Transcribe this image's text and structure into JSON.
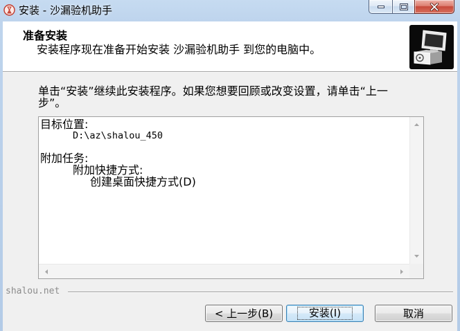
{
  "window": {
    "title": "安装 - 沙漏验机助手"
  },
  "header": {
    "title": "准备安装",
    "subtitle": "安装程序现在准备开始安装 沙漏验机助手 到您的电脑中。"
  },
  "body": {
    "instruction": "单击“安装”继续此安装程序。如果您想要回顾或改变设置，请单击“上一步”。"
  },
  "memo": {
    "sections": [
      {
        "label": "目标位置:",
        "items": [
          "D:\\az\\shalou_450"
        ]
      },
      {
        "label": "附加任务:",
        "groups": [
          {
            "label": "附加快捷方式:",
            "items": [
              "创建桌面快捷方式(D)"
            ]
          }
        ]
      }
    ]
  },
  "footer": {
    "brand": "shalou.net"
  },
  "buttons": {
    "back": "< 上一步(B)",
    "install": "安装(I)",
    "cancel": "取消"
  },
  "icons": {
    "app": "hourglass-icon",
    "minimize": "minimize-icon",
    "maximize": "maximize-icon",
    "close": "close-icon",
    "logo": "computer-setup-icon",
    "scroll_up": "scroll-up-arrow-icon",
    "scroll_down": "scroll-down-arrow-icon",
    "scroll_left": "scroll-left-arrow-icon",
    "scroll_right": "scroll-right-arrow-icon"
  },
  "colors": {
    "titlebar": "#c6dbf1",
    "header_bg": "#ffffff",
    "body_bg": "#f0f0f0",
    "close_button": "#c7493a",
    "focus_border": "#3c7fb1",
    "footer_text": "#8c8c8c"
  }
}
